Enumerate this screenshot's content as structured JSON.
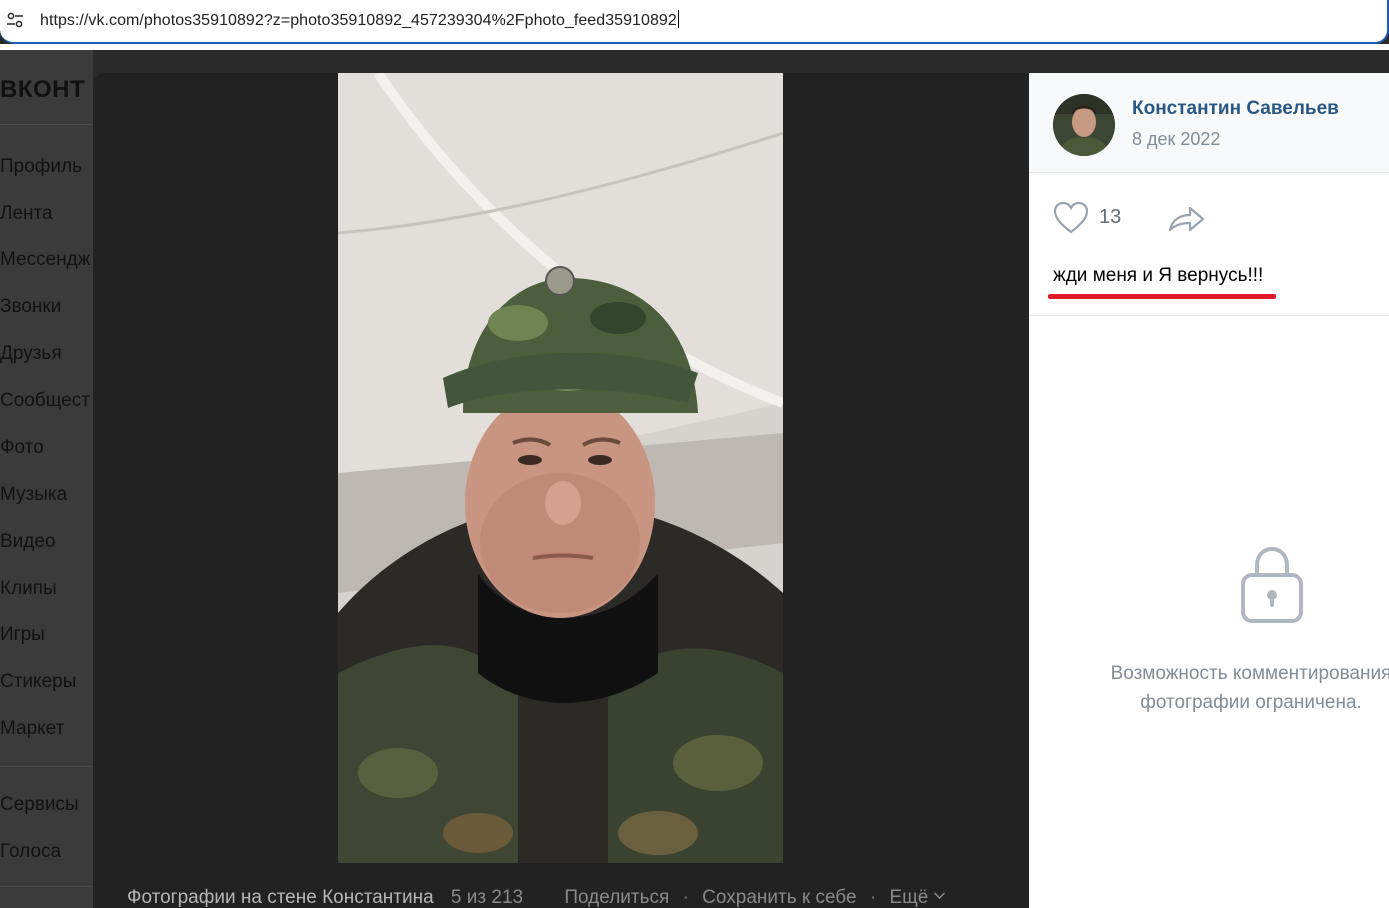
{
  "browser": {
    "url": "https://vk.com/photos35910892?z=photo35910892_457239304%2Fphoto_feed35910892",
    "site_info_icon": "tune-icon"
  },
  "sidebar": {
    "logo": "ВКОНТ",
    "items": [
      {
        "label": "Профиль"
      },
      {
        "label": "Лента"
      },
      {
        "label": "Мессендж"
      },
      {
        "label": "Звонки"
      },
      {
        "label": "Друзья"
      },
      {
        "label": "Сообщест"
      },
      {
        "label": "Фото"
      },
      {
        "label": "Музыка"
      },
      {
        "label": "Видео"
      },
      {
        "label": "Клипы"
      },
      {
        "label": "Игры"
      },
      {
        "label": "Стикеры"
      },
      {
        "label": "Маркет"
      }
    ],
    "extra_items": [
      {
        "label": "Сервисы"
      },
      {
        "label": "Голоса"
      }
    ]
  },
  "viewer": {
    "album_title": "Фотографии на стене Константина",
    "counter": "5 из 213",
    "share_label": "Поделиться",
    "save_label": "Сохранить к себе",
    "more_label": "Ещё",
    "separator": "·"
  },
  "post": {
    "author": "Константин Савельев",
    "date": "8 дек 2022",
    "likes": "13",
    "caption": "жди меня и Я вернусь!!!",
    "comments_closed_line1": "Возможность комментирования",
    "comments_closed_line2": "фотографии ограничена."
  },
  "colors": {
    "link": "#2a5885",
    "muted": "#818c99",
    "underline": "#e0192a",
    "viewer_bg": "#222222"
  }
}
